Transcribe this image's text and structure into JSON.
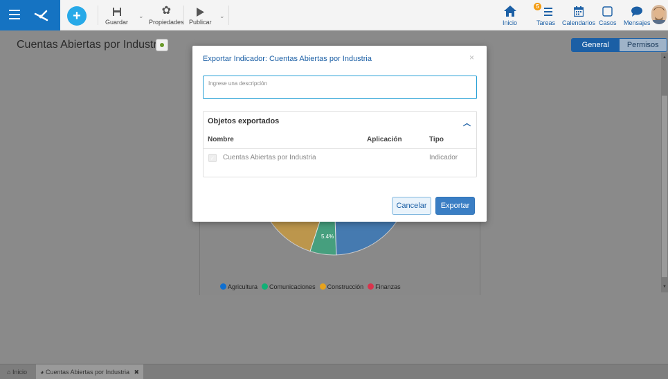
{
  "toolbar": {
    "save": "Guardar",
    "properties": "Propiedades",
    "publish": "Publicar",
    "home": "Inicio",
    "tasks": "Tareas",
    "tasks_badge": "5",
    "calendars": "Calendarios",
    "cases": "Casos",
    "messages": "Mensajes"
  },
  "page": {
    "title": "Cuentas Abiertas por Industria",
    "tab_general": "General",
    "tab_permissions": "Permisos"
  },
  "chart_data": {
    "type": "pie",
    "labels": [
      "Agricultura",
      "Comunicaciones",
      "Construcción",
      "Finanzas"
    ],
    "colors": [
      "#0f6fd1",
      "#10b176",
      "#e6a21c",
      "#d9334c"
    ],
    "data_labels": [
      "5.4%"
    ],
    "legend_position": "bottom"
  },
  "dialog": {
    "title": "Exportar Indicador: Cuentas Abiertas por Industria",
    "close": "×",
    "description_placeholder": "Ingrese una descripción",
    "objects_title": "Objetos exportados",
    "col_name": "Nombre",
    "col_app": "Aplicación",
    "col_type": "Tipo",
    "rows": [
      {
        "name": "Cuentas Abiertas por Industria",
        "app": "",
        "type": "Indicador"
      }
    ],
    "cancel": "Cancelar",
    "export": "Exportar"
  },
  "bottom_tabs": {
    "home": "Inicio",
    "current": "Cuentas Abiertas por Industria",
    "close": "✖"
  }
}
